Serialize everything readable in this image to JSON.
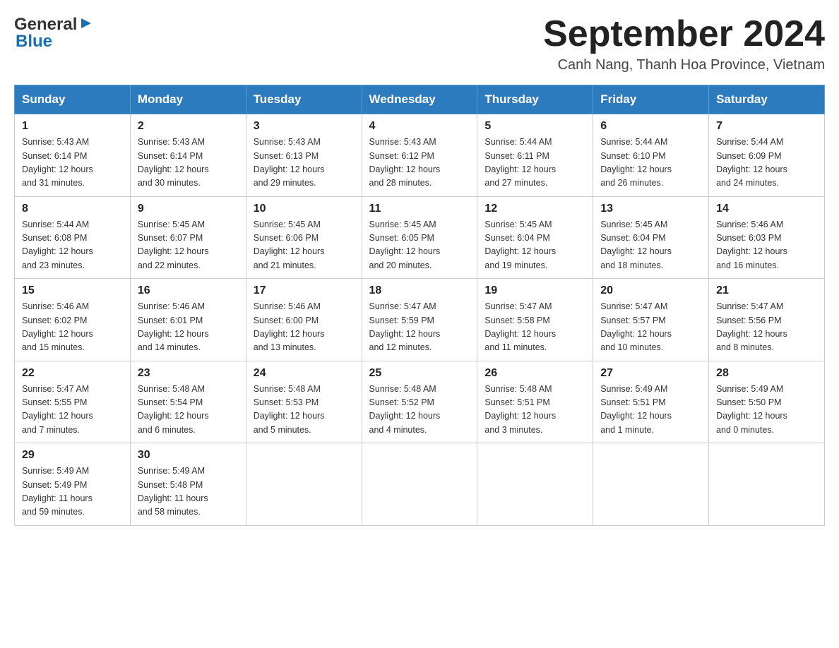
{
  "header": {
    "logo_general": "General",
    "logo_blue": "Blue",
    "title": "September 2024",
    "location": "Canh Nang, Thanh Hoa Province, Vietnam"
  },
  "weekdays": [
    "Sunday",
    "Monday",
    "Tuesday",
    "Wednesday",
    "Thursday",
    "Friday",
    "Saturday"
  ],
  "weeks": [
    [
      {
        "day": "1",
        "sunrise": "5:43 AM",
        "sunset": "6:14 PM",
        "daylight": "12 hours and 31 minutes."
      },
      {
        "day": "2",
        "sunrise": "5:43 AM",
        "sunset": "6:14 PM",
        "daylight": "12 hours and 30 minutes."
      },
      {
        "day": "3",
        "sunrise": "5:43 AM",
        "sunset": "6:13 PM",
        "daylight": "12 hours and 29 minutes."
      },
      {
        "day": "4",
        "sunrise": "5:43 AM",
        "sunset": "6:12 PM",
        "daylight": "12 hours and 28 minutes."
      },
      {
        "day": "5",
        "sunrise": "5:44 AM",
        "sunset": "6:11 PM",
        "daylight": "12 hours and 27 minutes."
      },
      {
        "day": "6",
        "sunrise": "5:44 AM",
        "sunset": "6:10 PM",
        "daylight": "12 hours and 26 minutes."
      },
      {
        "day": "7",
        "sunrise": "5:44 AM",
        "sunset": "6:09 PM",
        "daylight": "12 hours and 24 minutes."
      }
    ],
    [
      {
        "day": "8",
        "sunrise": "5:44 AM",
        "sunset": "6:08 PM",
        "daylight": "12 hours and 23 minutes."
      },
      {
        "day": "9",
        "sunrise": "5:45 AM",
        "sunset": "6:07 PM",
        "daylight": "12 hours and 22 minutes."
      },
      {
        "day": "10",
        "sunrise": "5:45 AM",
        "sunset": "6:06 PM",
        "daylight": "12 hours and 21 minutes."
      },
      {
        "day": "11",
        "sunrise": "5:45 AM",
        "sunset": "6:05 PM",
        "daylight": "12 hours and 20 minutes."
      },
      {
        "day": "12",
        "sunrise": "5:45 AM",
        "sunset": "6:04 PM",
        "daylight": "12 hours and 19 minutes."
      },
      {
        "day": "13",
        "sunrise": "5:45 AM",
        "sunset": "6:04 PM",
        "daylight": "12 hours and 18 minutes."
      },
      {
        "day": "14",
        "sunrise": "5:46 AM",
        "sunset": "6:03 PM",
        "daylight": "12 hours and 16 minutes."
      }
    ],
    [
      {
        "day": "15",
        "sunrise": "5:46 AM",
        "sunset": "6:02 PM",
        "daylight": "12 hours and 15 minutes."
      },
      {
        "day": "16",
        "sunrise": "5:46 AM",
        "sunset": "6:01 PM",
        "daylight": "12 hours and 14 minutes."
      },
      {
        "day": "17",
        "sunrise": "5:46 AM",
        "sunset": "6:00 PM",
        "daylight": "12 hours and 13 minutes."
      },
      {
        "day": "18",
        "sunrise": "5:47 AM",
        "sunset": "5:59 PM",
        "daylight": "12 hours and 12 minutes."
      },
      {
        "day": "19",
        "sunrise": "5:47 AM",
        "sunset": "5:58 PM",
        "daylight": "12 hours and 11 minutes."
      },
      {
        "day": "20",
        "sunrise": "5:47 AM",
        "sunset": "5:57 PM",
        "daylight": "12 hours and 10 minutes."
      },
      {
        "day": "21",
        "sunrise": "5:47 AM",
        "sunset": "5:56 PM",
        "daylight": "12 hours and 8 minutes."
      }
    ],
    [
      {
        "day": "22",
        "sunrise": "5:47 AM",
        "sunset": "5:55 PM",
        "daylight": "12 hours and 7 minutes."
      },
      {
        "day": "23",
        "sunrise": "5:48 AM",
        "sunset": "5:54 PM",
        "daylight": "12 hours and 6 minutes."
      },
      {
        "day": "24",
        "sunrise": "5:48 AM",
        "sunset": "5:53 PM",
        "daylight": "12 hours and 5 minutes."
      },
      {
        "day": "25",
        "sunrise": "5:48 AM",
        "sunset": "5:52 PM",
        "daylight": "12 hours and 4 minutes."
      },
      {
        "day": "26",
        "sunrise": "5:48 AM",
        "sunset": "5:51 PM",
        "daylight": "12 hours and 3 minutes."
      },
      {
        "day": "27",
        "sunrise": "5:49 AM",
        "sunset": "5:51 PM",
        "daylight": "12 hours and 1 minute."
      },
      {
        "day": "28",
        "sunrise": "5:49 AM",
        "sunset": "5:50 PM",
        "daylight": "12 hours and 0 minutes."
      }
    ],
    [
      {
        "day": "29",
        "sunrise": "5:49 AM",
        "sunset": "5:49 PM",
        "daylight": "11 hours and 59 minutes."
      },
      {
        "day": "30",
        "sunrise": "5:49 AM",
        "sunset": "5:48 PM",
        "daylight": "11 hours and 58 minutes."
      },
      null,
      null,
      null,
      null,
      null
    ]
  ],
  "labels": {
    "sunrise": "Sunrise:",
    "sunset": "Sunset:",
    "daylight": "Daylight:"
  }
}
